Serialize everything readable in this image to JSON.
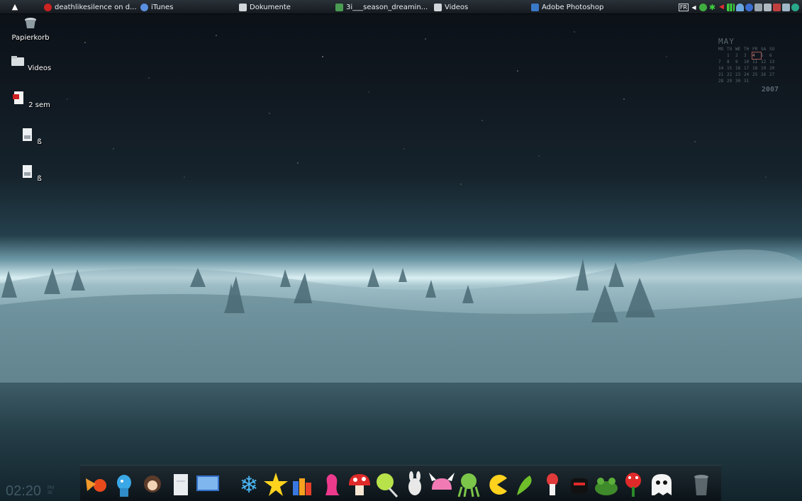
{
  "taskbar": {
    "items": [
      {
        "label": "deathlikesilence on d...",
        "icon": "opera-icon",
        "color": "#cc2222"
      },
      {
        "label": "iTunes",
        "icon": "itunes-icon",
        "color": "#5a8ee0"
      },
      {
        "label": "Dokumente",
        "icon": "folder-icon",
        "color": "#d0d6da"
      },
      {
        "label": "3i___season_dreamin...",
        "icon": "image-file-icon",
        "color": "#4a9c52"
      },
      {
        "label": "Videos",
        "icon": "folder-icon",
        "color": "#d0d6da"
      },
      {
        "label": "Adobe Photoshop",
        "icon": "photoshop-icon",
        "color": "#3a78c8"
      }
    ],
    "tray": {
      "lang": "FR",
      "icons": [
        "arrow-left-icon",
        "messenger-icon",
        "asterisk-icon",
        "volume-icon",
        "signal-icon",
        "flame-icon",
        "network-icon",
        "monitor-icon",
        "network-icon",
        "network-icon",
        "monitor-icon",
        "globe-icon"
      ]
    }
  },
  "desktop": {
    "icons": [
      {
        "label": "Papierkorb",
        "icon": "recycle-bin-icon"
      },
      {
        "label": "Videos",
        "icon": "folder-icon"
      },
      {
        "label": "2 sem",
        "icon": "pdf-file-icon"
      },
      {
        "label": "ß",
        "icon": "text-file-icon"
      },
      {
        "label": "ß",
        "icon": "text-file-icon"
      }
    ]
  },
  "calendar": {
    "month": "MAY",
    "year": "2007",
    "weekdays": [
      "MO",
      "TU",
      "WE",
      "TH",
      "FR",
      "SA",
      "SU"
    ],
    "weeks": [
      [
        "",
        "1",
        "2",
        "3",
        "4",
        "5",
        "6"
      ],
      [
        "7",
        "8",
        "9",
        "10",
        "11",
        "12",
        "13"
      ],
      [
        "14",
        "15",
        "16",
        "17",
        "18",
        "19",
        "20"
      ],
      [
        "21",
        "22",
        "23",
        "24",
        "25",
        "26",
        "27"
      ],
      [
        "28",
        "29",
        "30",
        "31",
        "",
        "",
        ""
      ]
    ],
    "today": "4"
  },
  "clock": {
    "time": "02:20",
    "ampm": "PM",
    "seconds": "35"
  },
  "dock": {
    "icons": [
      "comet-icon",
      "blue-creature-icon",
      "warrior-icon",
      "document-icon",
      "monitor-icon",
      "snowflake-icon",
      "star-icon",
      "crayons-icon",
      "pink-worm-icon",
      "mushroom-icon",
      "lollipop-icon",
      "bunny-icon",
      "viking-helmet-icon",
      "octopus-icon",
      "pacman-icon",
      "dragon-icon",
      "squid-icon",
      "ninja-icon",
      "frog-icon",
      "piranha-plant-icon",
      "ghost-icon",
      "trash-can-icon"
    ]
  }
}
